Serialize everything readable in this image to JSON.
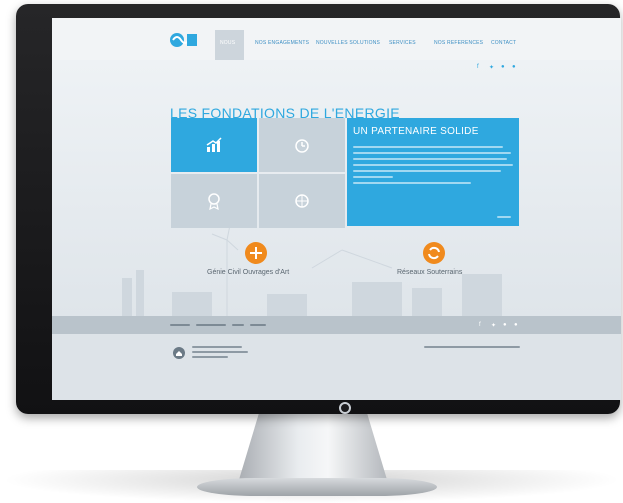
{
  "site": {
    "nav": {
      "items": [
        {
          "label": "NOUS"
        },
        {
          "label": "NOS ENGAGEMENTS"
        },
        {
          "label": "NOUVELLES SOLUTIONS"
        },
        {
          "label": "SERVICES"
        },
        {
          "label": "NOS REFERENCES"
        },
        {
          "label": "CONTACT"
        }
      ]
    },
    "page_title": "LES FONDATIONS DE L'ENERGIE",
    "feature": {
      "title": "UN PARTENAIRE SOLIDE"
    },
    "services": [
      {
        "label": "Génie Civil Ouvrages d'Art"
      },
      {
        "label": "Réseaux Souterrains"
      }
    ]
  },
  "colors": {
    "accent_blue": "#2fa8df",
    "orange": "#f08a1d",
    "tile_gray": "#c7d2da"
  },
  "icons": [
    "chart-icon",
    "clock-icon",
    "award-icon",
    "globe-icon",
    "service-icon",
    "cycle-icon",
    "twitter-icon",
    "facebook-icon",
    "home-icon"
  ]
}
